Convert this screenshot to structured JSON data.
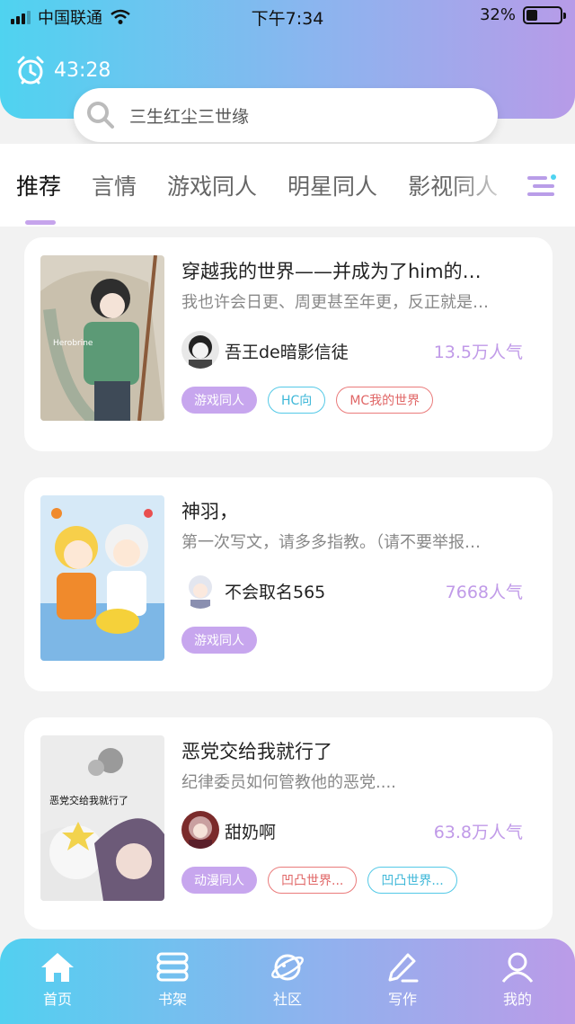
{
  "status": {
    "carrier": "中国联通",
    "time": "下午7:34",
    "battery": "32%",
    "battery_level": 0.32
  },
  "timer": {
    "value": "43:28"
  },
  "search": {
    "placeholder": "三生红尘三世缘"
  },
  "tabs": [
    {
      "label": "推荐",
      "active": true
    },
    {
      "label": "言情",
      "active": false
    },
    {
      "label": "游戏同人",
      "active": false
    },
    {
      "label": "明星同人",
      "active": false
    },
    {
      "label": "影视同人",
      "active": false
    }
  ],
  "books": [
    {
      "title": "穿越我的世界——并成为了him的…",
      "desc": "我也许会日更、周更甚至年更，反正就是…",
      "author": "吾王de暗影信徒",
      "popularity": "13.5万人气",
      "cover_text": "Herobrine",
      "tags": [
        {
          "label": "游戏同人",
          "style": "filled"
        },
        {
          "label": "HC向",
          "style": "cyan"
        },
        {
          "label": "MC我的世界",
          "style": "red"
        }
      ]
    },
    {
      "title": "神羽，",
      "desc": "第一次写文，请多多指教。（请不要举报…",
      "author": "不会取名565",
      "popularity": "7668人气",
      "tags": [
        {
          "label": "游戏同人",
          "style": "filled"
        }
      ]
    },
    {
      "title": "恶党交给我就行了",
      "desc": "纪律委员如何管教他的恶党....",
      "author": "甜奶啊",
      "popularity": "63.8万人气",
      "cover_text": "恶党交给我就行了",
      "tags": [
        {
          "label": "动漫同人",
          "style": "filled"
        },
        {
          "label": "凹凸世界...",
          "style": "red"
        },
        {
          "label": "凹凸世界...",
          "style": "cyan"
        }
      ]
    }
  ],
  "bottom_nav": [
    {
      "label": "首页",
      "icon": "home-icon"
    },
    {
      "label": "书架",
      "icon": "bookshelf-icon"
    },
    {
      "label": "社区",
      "icon": "planet-icon"
    },
    {
      "label": "写作",
      "icon": "pen-icon"
    },
    {
      "label": "我的",
      "icon": "user-icon"
    }
  ],
  "colors": {
    "accent": "#c7a6ee",
    "cyan": "#54c9e7",
    "red": "#ea7b7b",
    "header_start": "#4fd3f0",
    "header_end": "#b79be8"
  }
}
